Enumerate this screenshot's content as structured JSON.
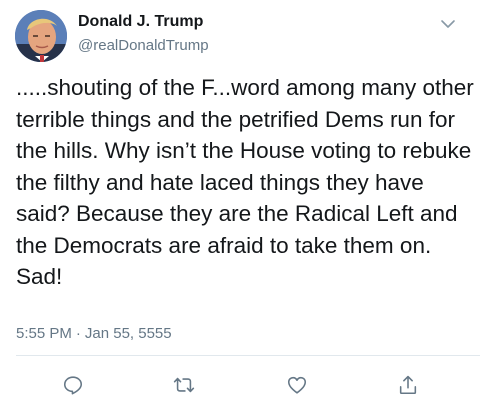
{
  "user": {
    "display_name": "Donald J. Trump",
    "handle": "@realDonaldTrump",
    "avatar_icon": "profile-photo"
  },
  "tweet": {
    "text": ".....shouting of the F...word among many other terrible things and the petrified Dems run for the hills. Why isn’t the House voting to rebuke the filthy and hate laced things they have said? Because they are the Radical Left and the Democrats are afraid to take them on. Sad!",
    "time": "5:55 PM",
    "separator": "·",
    "date": "Jan 55, 5555"
  },
  "menu": {
    "icon": "chevron-down-icon"
  },
  "actions": [
    {
      "name": "reply",
      "icon": "reply-icon"
    },
    {
      "name": "retweet",
      "icon": "retweet-icon"
    },
    {
      "name": "like",
      "icon": "heart-icon"
    },
    {
      "name": "share",
      "icon": "share-icon"
    }
  ],
  "colors": {
    "text": "#14171a",
    "secondary": "#657786",
    "divider": "#e1e8ed",
    "icon": "#657786"
  }
}
